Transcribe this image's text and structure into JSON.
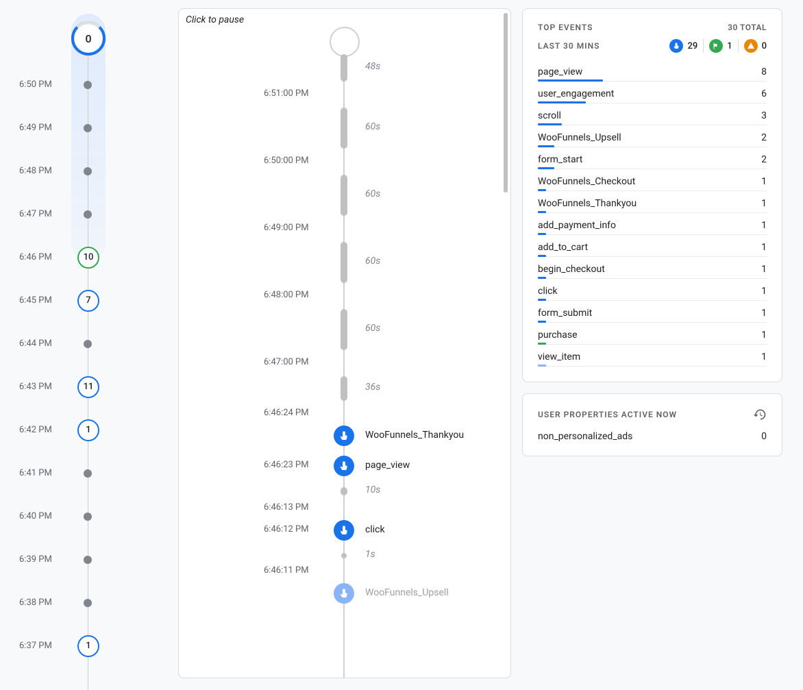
{
  "left_timeline": {
    "top_value": "0",
    "rows": [
      {
        "time": "6:50 PM",
        "type": "dot"
      },
      {
        "time": "6:49 PM",
        "type": "dot"
      },
      {
        "time": "6:48 PM",
        "type": "dot"
      },
      {
        "time": "6:47 PM",
        "type": "dot"
      },
      {
        "time": "6:46 PM",
        "type": "circle",
        "value": "10",
        "variant": "green"
      },
      {
        "time": "6:45 PM",
        "type": "circle",
        "value": "7",
        "variant": "blue"
      },
      {
        "time": "6:44 PM",
        "type": "dot"
      },
      {
        "time": "6:43 PM",
        "type": "circle",
        "value": "11",
        "variant": "blue"
      },
      {
        "time": "6:42 PM",
        "type": "circle",
        "value": "1",
        "variant": "blue"
      },
      {
        "time": "6:41 PM",
        "type": "dot"
      },
      {
        "time": "6:40 PM",
        "type": "dot"
      },
      {
        "time": "6:39 PM",
        "type": "dot"
      },
      {
        "time": "6:38 PM",
        "type": "dot"
      },
      {
        "time": "6:37 PM",
        "type": "circle",
        "value": "1",
        "variant": "blue"
      }
    ]
  },
  "stream": {
    "hint": "Click to pause",
    "items": [
      {
        "kind": "gap",
        "duration": "48s",
        "pill_h": 40
      },
      {
        "kind": "tick",
        "time": "6:51:00 PM"
      },
      {
        "kind": "gap",
        "duration": "60s",
        "pill_h": 60
      },
      {
        "kind": "tick",
        "time": "6:50:00 PM"
      },
      {
        "kind": "gap",
        "duration": "60s",
        "pill_h": 60
      },
      {
        "kind": "tick",
        "time": "6:49:00 PM"
      },
      {
        "kind": "gap",
        "duration": "60s",
        "pill_h": 60
      },
      {
        "kind": "tick",
        "time": "6:48:00 PM"
      },
      {
        "kind": "gap",
        "duration": "60s",
        "pill_h": 60
      },
      {
        "kind": "tick",
        "time": "6:47:00 PM"
      },
      {
        "kind": "gap",
        "duration": "36s",
        "pill_h": 36
      },
      {
        "kind": "tick",
        "time": "6:46:24 PM"
      },
      {
        "kind": "event",
        "label": "WooFunnels_Thankyou"
      },
      {
        "kind": "event",
        "label": "page_view",
        "time": "6:46:23 PM"
      },
      {
        "kind": "gap",
        "duration": "10s",
        "pill_h": 12
      },
      {
        "kind": "tick",
        "time": "6:46:13 PM"
      },
      {
        "kind": "event",
        "label": "click",
        "time": "6:46:12 PM"
      },
      {
        "kind": "gap_small",
        "duration": "1s"
      },
      {
        "kind": "tick",
        "time": "6:46:11 PM"
      },
      {
        "kind": "event",
        "label": "WooFunnels_Upsell",
        "faded": true
      }
    ]
  },
  "top_events": {
    "title": "TOP EVENTS",
    "total_label": "30 TOTAL",
    "subtitle": "LAST 30 MINS",
    "badges": {
      "blue": "29",
      "green": "1",
      "orange": "0"
    },
    "items": [
      {
        "name": "page_view",
        "count": "8",
        "bar": 95,
        "color": "#1a73e8"
      },
      {
        "name": "user_engagement",
        "count": "6",
        "bar": 70,
        "color": "#1a73e8"
      },
      {
        "name": "scroll",
        "count": "3",
        "bar": 35,
        "color": "#1a73e8"
      },
      {
        "name": "WooFunnels_Upsell",
        "count": "2",
        "bar": 24,
        "color": "#1a73e8"
      },
      {
        "name": "form_start",
        "count": "2",
        "bar": 24,
        "color": "#1a73e8"
      },
      {
        "name": "WooFunnels_Checkout",
        "count": "1",
        "bar": 12,
        "color": "#1a73e8"
      },
      {
        "name": "WooFunnels_Thankyou",
        "count": "1",
        "bar": 12,
        "color": "#1a73e8"
      },
      {
        "name": "add_payment_info",
        "count": "1",
        "bar": 12,
        "color": "#1a73e8"
      },
      {
        "name": "add_to_cart",
        "count": "1",
        "bar": 12,
        "color": "#1a73e8"
      },
      {
        "name": "begin_checkout",
        "count": "1",
        "bar": 12,
        "color": "#1a73e8"
      },
      {
        "name": "click",
        "count": "1",
        "bar": 12,
        "color": "#1a73e8"
      },
      {
        "name": "form_submit",
        "count": "1",
        "bar": 12,
        "color": "#1a73e8"
      },
      {
        "name": "purchase",
        "count": "1",
        "bar": 12,
        "color": "#34a853"
      },
      {
        "name": "view_item",
        "count": "1",
        "bar": 12,
        "color": "#8ab4f8"
      }
    ]
  },
  "user_properties": {
    "title": "USER PROPERTIES ACTIVE NOW",
    "rows": [
      {
        "name": "non_personalized_ads",
        "value": "0"
      }
    ]
  }
}
